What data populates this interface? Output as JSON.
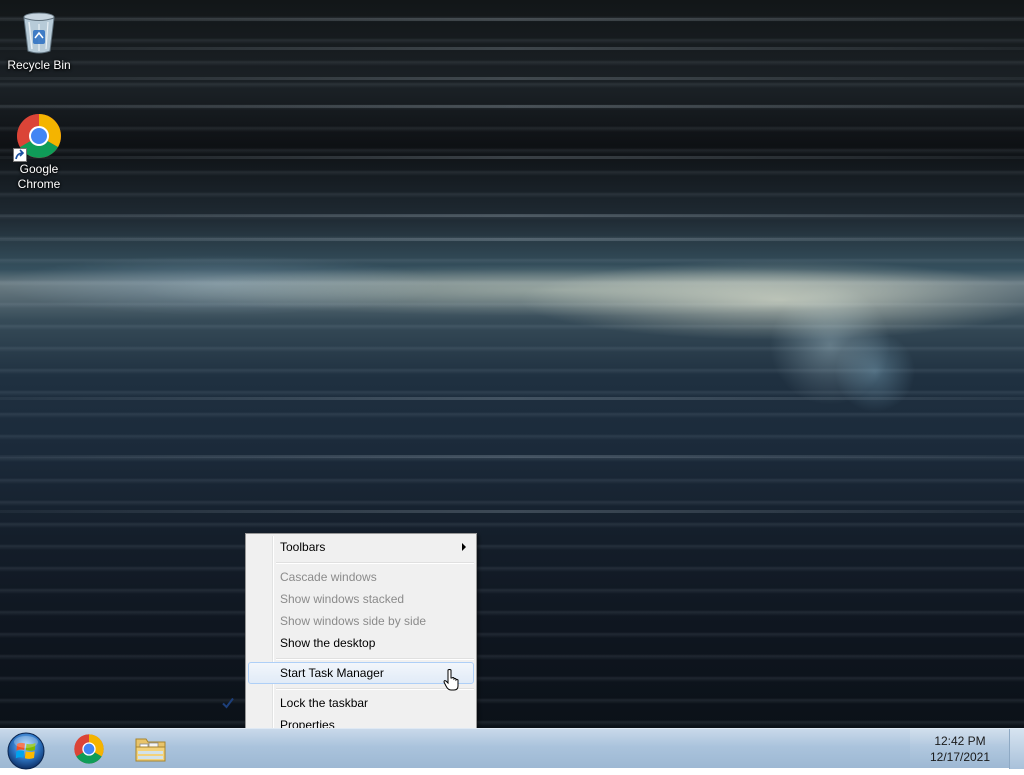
{
  "desktop": {
    "icons": [
      {
        "label": "Recycle Bin",
        "icon": "recycle-bin-icon"
      },
      {
        "label": "Google\nChrome",
        "icon": "chrome-icon"
      }
    ]
  },
  "context_menu": {
    "items": [
      {
        "label": "Toolbars",
        "enabled": true,
        "submenu": true
      },
      {
        "label": "Cascade windows",
        "enabled": false
      },
      {
        "label": "Show windows stacked",
        "enabled": false
      },
      {
        "label": "Show windows side by side",
        "enabled": false
      },
      {
        "label": "Show the desktop",
        "enabled": true
      },
      {
        "label": "Start Task Manager",
        "enabled": true,
        "highlighted": true
      },
      {
        "label": "Lock the taskbar",
        "enabled": true,
        "checked": true
      },
      {
        "label": "Properties",
        "enabled": true
      }
    ]
  },
  "taskbar": {
    "start_button": "windows-start-orb-icon",
    "pinned": [
      {
        "name": "Google Chrome",
        "icon": "chrome-icon"
      },
      {
        "name": "Windows Explorer",
        "icon": "folder-icon"
      }
    ],
    "clock": {
      "time": "12:42 PM",
      "date": "12/17/2021"
    }
  },
  "colors": {
    "taskbar": "#aac3dc",
    "menu_background": "#f0f0f0",
    "menu_highlight_border": "#aecff7",
    "disabled_text": "#8b8b8b"
  }
}
